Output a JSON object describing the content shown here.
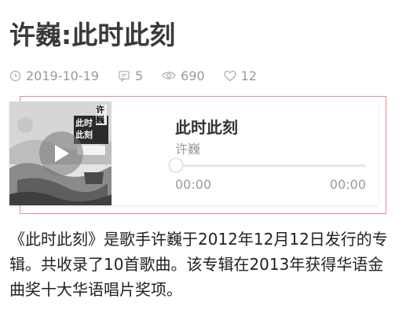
{
  "article": {
    "title": "许巍:此时此刻",
    "meta": {
      "date": "2019-10-19",
      "comments": "5",
      "views": "690",
      "likes": "12"
    },
    "description": "《此时此刻》是歌手许巍于2012年12月12日发行的专辑。共收录了10首歌曲。该专辑在2013年获得华语金曲奖十大华语唱片奖项。"
  },
  "player": {
    "song_title": "此时此刻",
    "artist": "许巍",
    "current_time": "00:00",
    "total_time": "00:00",
    "progress": 0,
    "cover_text": [
      "此时",
      "此刻",
      "许巍"
    ]
  },
  "icons": {
    "date": "clock-icon",
    "comments": "comment-icon",
    "views": "eye-icon",
    "likes": "heart-icon",
    "play": "play-icon"
  },
  "colors": {
    "highlight_border": "#f08a8a",
    "meta_text": "#9a9a9a",
    "title_text": "#3a3a3a"
  }
}
